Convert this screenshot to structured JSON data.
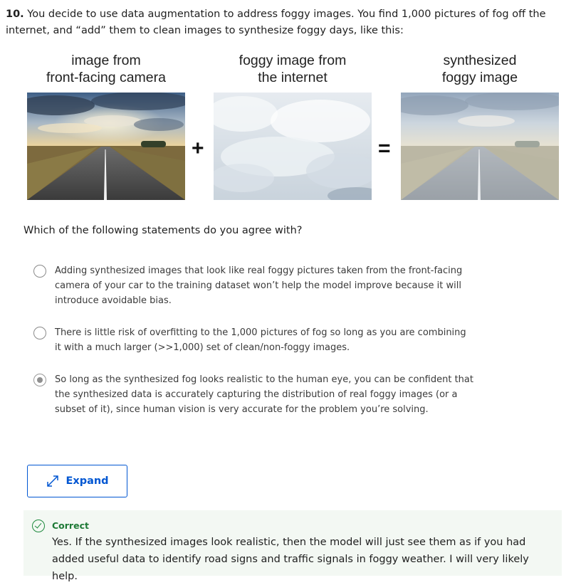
{
  "question": {
    "number": "10.",
    "text": "You decide to use data augmentation to address foggy images. You find 1,000 pictures of fog off the internet, and “add” them to clean images to synthesize foggy days, like this:"
  },
  "figure": {
    "captions": [
      "image from\nfront-facing camera",
      "foggy image from\nthe internet",
      "synthesized\nfoggy image"
    ],
    "plus": "+",
    "equals": "="
  },
  "prompt": "Which of the following statements do you agree with?",
  "options": [
    {
      "text": "Adding synthesized images that look like real foggy pictures taken from the front-facing camera of your car to the training dataset won’t help the model improve because it will introduce avoidable bias.",
      "selected": false
    },
    {
      "text": "There is little risk of overfitting to the 1,000 pictures of fog so long as you are combining it with a much larger (>>1,000) set of clean/non-foggy images.",
      "selected": false
    },
    {
      "text": "So long as the synthesized fog looks realistic to the human eye, you can be confident that the synthesized data is accurately capturing the distribution of real foggy images (or a subset of it), since human vision is very accurate for the problem you’re solving.",
      "selected": true
    }
  ],
  "expand": {
    "label": "Expand",
    "icon": "expand-arrows-icon"
  },
  "feedback": {
    "status": "Correct",
    "text": "Yes. If the synthesized images look realistic, then the model will just see them as if you had added useful data to identify road signs and traffic signals in foggy weather. I will very likely help."
  },
  "colors": {
    "accent": "#0056d2",
    "correct": "#1e8a3e",
    "feedback_bg": "#f3f8f3"
  }
}
